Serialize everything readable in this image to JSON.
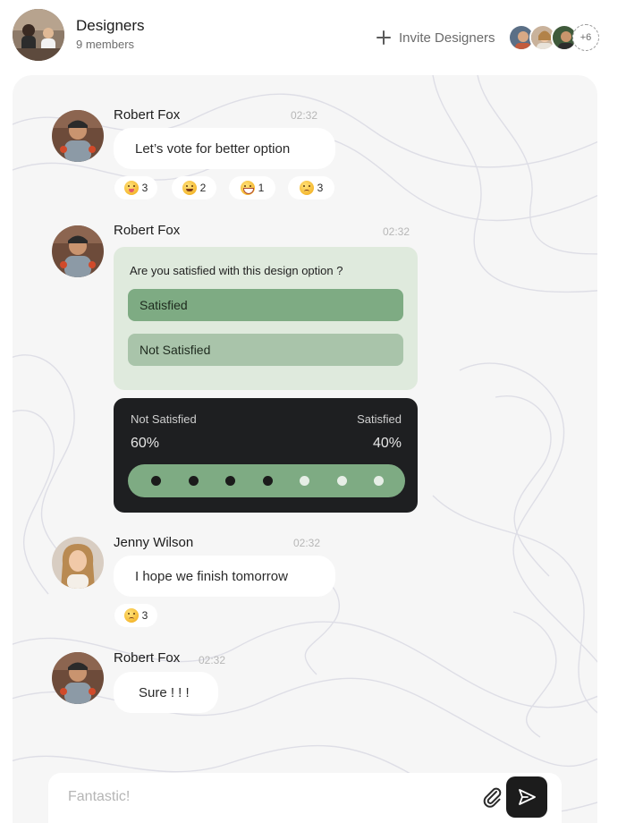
{
  "header": {
    "title": "Designers",
    "subtitle": "9 members",
    "invite_label": "Invite Designers",
    "more_members": "+6"
  },
  "messages": [
    {
      "author": "Robert Fox",
      "time": "02:32",
      "text": "Let’s vote for better option",
      "reactions": [
        {
          "icon": "tongue-emoji-icon",
          "count": "3"
        },
        {
          "icon": "grin-emoji-icon",
          "count": "2"
        },
        {
          "icon": "laugh-emoji-icon",
          "count": "1"
        },
        {
          "icon": "sad-emoji-icon",
          "count": "3"
        }
      ]
    },
    {
      "author": "Robert Fox",
      "time": "02:32",
      "poll": {
        "question": "Are you satisfied with this design option ?",
        "options": [
          "Satisfied",
          "Not Satisfied"
        ],
        "results": {
          "left_label": "Not Satisfied",
          "left_value": "60%",
          "right_label": "Satisfied",
          "right_value": "40%",
          "dots_filled": 4,
          "dots_total": 7
        }
      }
    },
    {
      "author": "Jenny Wilson",
      "time": "02:32",
      "text": "I hope we finish tomorrow",
      "reactions": [
        {
          "icon": "sad-emoji-icon",
          "count": "3"
        }
      ]
    },
    {
      "author": "Robert Fox",
      "time": "02:32",
      "text": "Sure ! ! !"
    }
  ],
  "composer": {
    "placeholder": "Fantastic!"
  },
  "colors": {
    "poll_bg": "#dfeadd",
    "option_selected": "#7eab83",
    "option_unselected": "#a9c4aa",
    "results_bg": "#1e1f21",
    "send_button": "#1c1c1c"
  }
}
